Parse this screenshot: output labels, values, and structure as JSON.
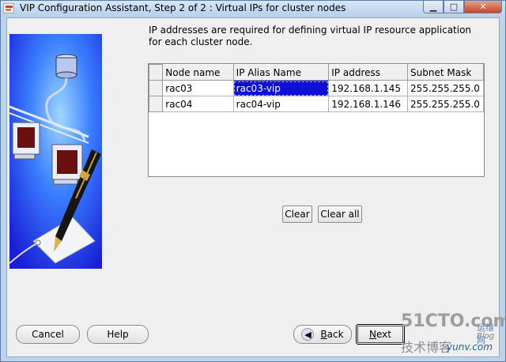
{
  "window": {
    "title": "VIP Configuration Assistant, Step 2 of 2 : Virtual IPs for cluster nodes",
    "controls": {
      "minimize": "▁",
      "maximize": "□",
      "close": "✕"
    }
  },
  "illustration": {
    "icon": "cluster-network-illustration"
  },
  "description": "IP addresses are required for defining virtual IP resource application for each cluster node.",
  "table": {
    "headers": [
      "Node name",
      "IP Alias Name",
      "IP address",
      "Subnet Mask"
    ],
    "rows": [
      {
        "node": "rac03",
        "alias": "rac03-vip",
        "ip": "192.168.1.145",
        "mask": "255.255.255.0"
      },
      {
        "node": "rac04",
        "alias": "rac04-vip",
        "ip": "192.168.1.146",
        "mask": "255.255.255.0"
      }
    ]
  },
  "buttons": {
    "clear": "Clear",
    "clear_all": "Clear all",
    "cancel": "Cancel",
    "help": "Help",
    "back": "Back",
    "next": "Next"
  },
  "watermark": {
    "brand": "51CTO.com",
    "tagline": "技术博客",
    "blog": "Blog",
    "site": "yunv.com",
    "cn_small": "运维网"
  },
  "colors": {
    "titlebar": "#c6dcf2",
    "panel": "#efefef",
    "selection": "#0f0fd6",
    "close_button": "#c7452a"
  }
}
